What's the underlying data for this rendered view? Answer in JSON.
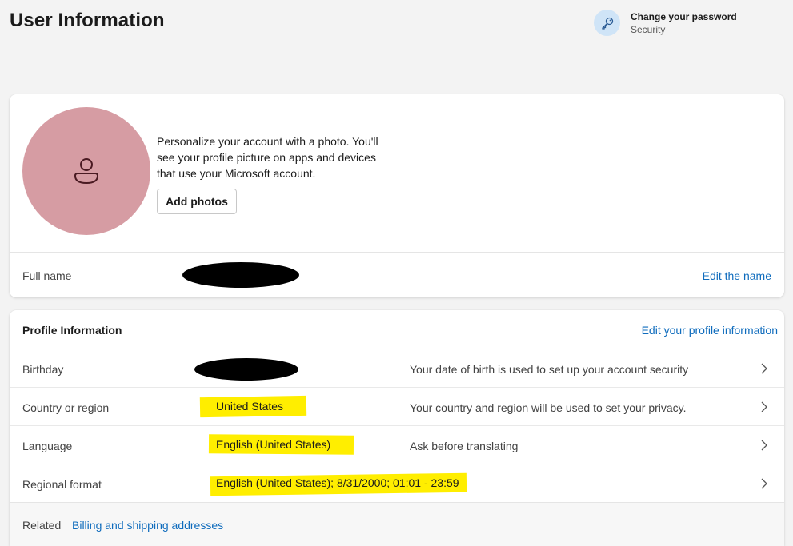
{
  "page": {
    "title": "User Information"
  },
  "password_link": {
    "title": "Change your password",
    "subtitle": "Security",
    "icon": "key-icon",
    "icon_bg": "#cfe4f7"
  },
  "photo_card": {
    "avatar_color": "#d69ca3",
    "avatar_icon": "person-icon",
    "description": "Personalize your account with a photo. You'll see your profile picture on apps and devices that use your Microsoft account.",
    "add_button": "Add photos",
    "full_name_label": "Full name",
    "edit_name_link": "Edit the name"
  },
  "profile": {
    "title": "Profile Information",
    "edit_link": "Edit your profile information",
    "rows": [
      {
        "label": "Birthday",
        "value": "",
        "description": "Your date of birth is used to set up your account security"
      },
      {
        "label": "Country or region",
        "value": "United States",
        "description": "Your country and region will be used to set your privacy."
      },
      {
        "label": "Language",
        "value": "English (United States)",
        "description": "Ask before translating"
      },
      {
        "label": "Regional format",
        "value": "English (United States); 8/31/2000; 01:01 - 23:59",
        "description": ""
      }
    ],
    "related_label": "Related",
    "related_link": "Billing and shipping addresses"
  },
  "colors": {
    "link": "#0f6cbd",
    "highlight": "#ffee00",
    "background": "#f3f3f3"
  }
}
